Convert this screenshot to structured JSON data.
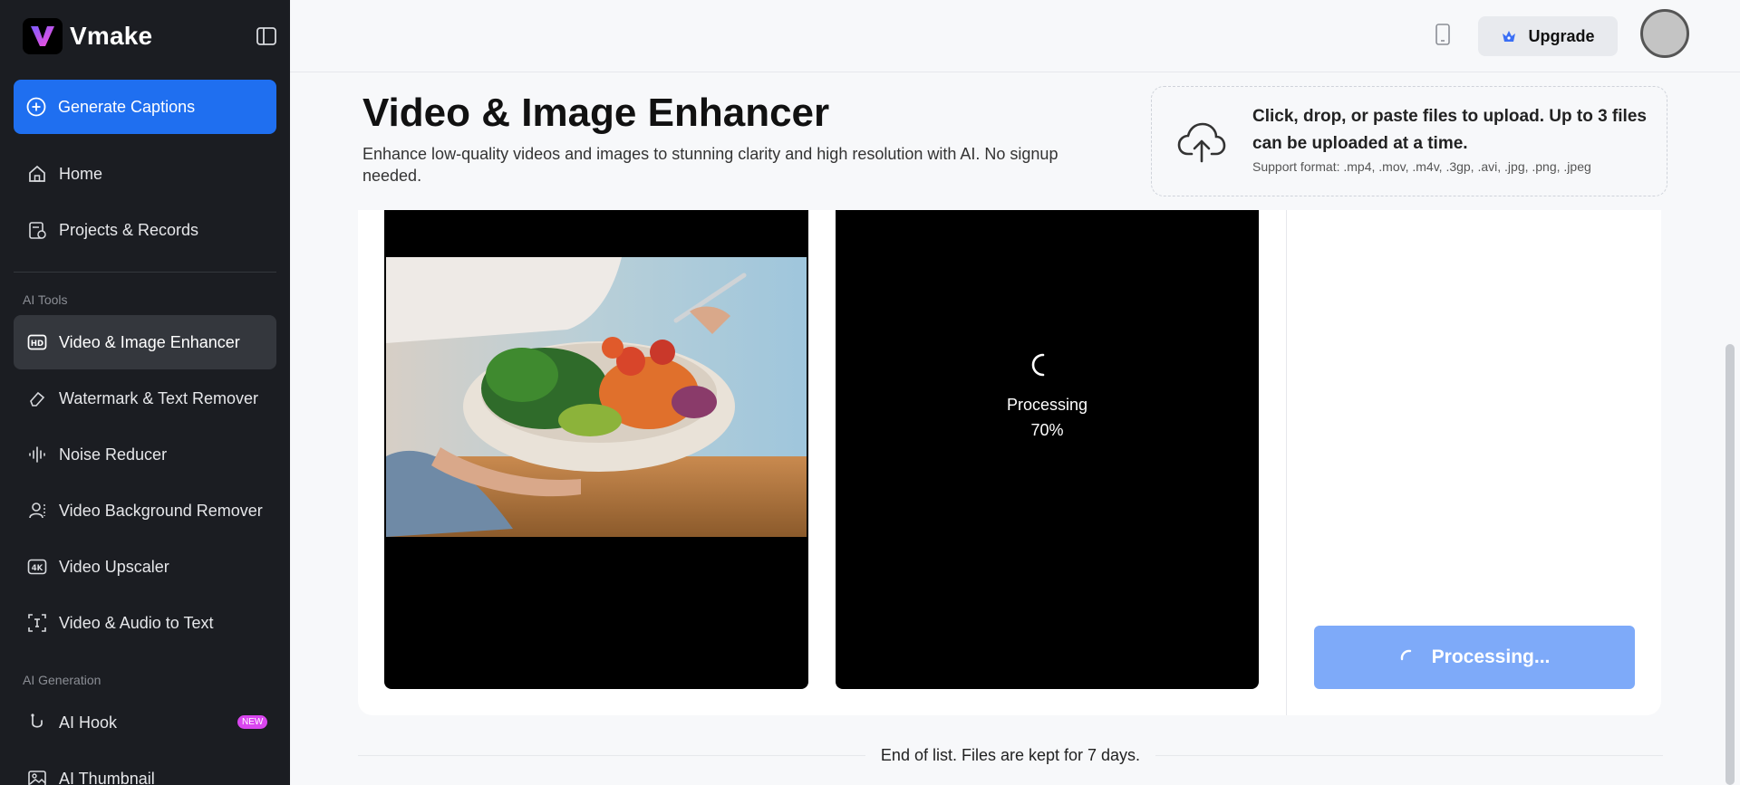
{
  "app": {
    "name": "Vmake"
  },
  "sidebar": {
    "generate_label": "Generate Captions",
    "items": [
      {
        "label": "Home",
        "icon": "home-icon"
      },
      {
        "label": "Projects & Records",
        "icon": "records-icon"
      }
    ],
    "section_tools": "AI Tools",
    "tools": [
      {
        "label": "Video & Image Enhancer",
        "icon": "hd-icon"
      },
      {
        "label": "Watermark & Text Remover",
        "icon": "eraser-icon"
      },
      {
        "label": "Noise Reducer",
        "icon": "soundwave-icon"
      },
      {
        "label": "Video Background Remover",
        "icon": "person-cutout-icon"
      },
      {
        "label": "Video Upscaler",
        "icon": "4k-icon"
      },
      {
        "label": "Video & Audio to Text",
        "icon": "text-icon"
      }
    ],
    "section_generation": "AI Generation",
    "generation": [
      {
        "label": "AI Hook",
        "icon": "hook-icon",
        "badge": "NEW"
      },
      {
        "label": "AI Thumbnail",
        "icon": "image-icon"
      }
    ]
  },
  "topbar": {
    "upgrade_label": "Upgrade"
  },
  "header": {
    "title": "Video & Image Enhancer",
    "subtitle": "Enhance low-quality videos and images to stunning clarity and high resolution with AI. No signup needed."
  },
  "upload": {
    "title": "Click, drop, or paste files to upload. Up to 3 files can be uploaded at a time.",
    "formats": "Support format: .mp4, .mov, .m4v, .3gp, .avi, .jpg, .png, .jpeg"
  },
  "preview": {
    "processing_label": "Processing",
    "progress_text": "70%",
    "progress": 0.7
  },
  "action": {
    "button_label": "Processing..."
  },
  "footer": {
    "end_text": "End of list. Files are kept for 7 days."
  },
  "colors": {
    "sidebar_bg": "#1b1d22",
    "accent": "#1f6ff0",
    "processing_btn": "#7eaaf9",
    "new_badge": "#d946ef"
  }
}
